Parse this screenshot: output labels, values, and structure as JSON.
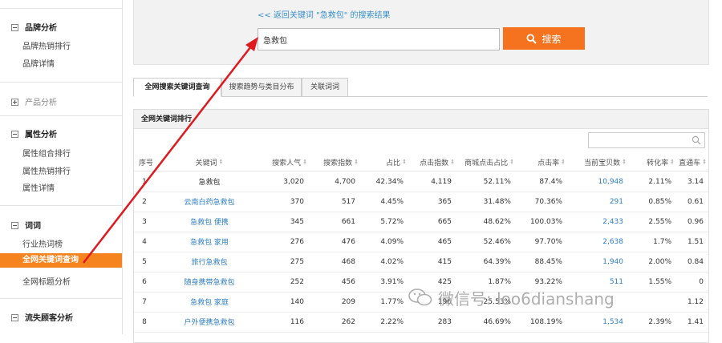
{
  "sidebar": {
    "sections": [
      {
        "title": "品牌分析",
        "collapsed": false,
        "items": [
          "品牌热销排行",
          "品牌详情"
        ]
      },
      {
        "title": "产品分析",
        "collapsed": true,
        "items": []
      },
      {
        "title": "属性分析",
        "collapsed": false,
        "items": [
          "属性组合排行",
          "属性热销排行",
          "属性详情"
        ]
      },
      {
        "title": "词词",
        "collapsed": false,
        "items": [
          "行业热词榜",
          "全网关键词查询",
          "全网标题分析"
        ]
      },
      {
        "title": "流失顾客分析",
        "collapsed": false,
        "items": []
      }
    ],
    "active_item": "全网关键词查询"
  },
  "search": {
    "back_link": "<< 返回关键词 \"急救包\" 的搜索结果",
    "value": "急救包",
    "button_label": "搜索"
  },
  "tabs": [
    "全网搜索关键词查询",
    "搜索趋势与类目分布",
    "关联词词"
  ],
  "panel": {
    "title": "全网关键词排行",
    "filter_placeholder": ""
  },
  "table": {
    "columns": [
      "序号",
      "关键词",
      "搜索人气",
      "搜索指数",
      "占比",
      "点击指数",
      "商城点击占比",
      "点击率",
      "当前宝贝数",
      "转化率",
      "直通车"
    ],
    "rows": [
      [
        "1",
        "急救包",
        "3,020",
        "4,700",
        "42.34%",
        "4,119",
        "52.11%",
        "87.4%",
        "10,948",
        "2.11%",
        "3.14"
      ],
      [
        "2",
        "云南白药急救包",
        "370",
        "517",
        "4.45%",
        "365",
        "31.48%",
        "70.36%",
        "291",
        "0.85%",
        "0.61"
      ],
      [
        "3",
        "急救包 便携",
        "345",
        "661",
        "5.72%",
        "665",
        "48.62%",
        "100.03%",
        "2,433",
        "2.55%",
        "0.96"
      ],
      [
        "4",
        "急救包 家用",
        "276",
        "476",
        "4.09%",
        "465",
        "52.46%",
        "97.70%",
        "2,638",
        "1.7%",
        "1.51"
      ],
      [
        "5",
        "旅行急救包",
        "275",
        "468",
        "4.02%",
        "415",
        "64.39%",
        "88.45%",
        "1,940",
        "2.00%",
        "0.84"
      ],
      [
        "6",
        "随身携带急救包",
        "252",
        "456",
        "3.91%",
        "425",
        "1.87%",
        "93.22%",
        "511",
        "1.55%",
        "0"
      ],
      [
        "7",
        "急救包 家庭",
        "140",
        "209",
        "1.77%",
        "196",
        "25.53%",
        "",
        "",
        "",
        "1.12"
      ],
      [
        "8",
        "户外便携急救包",
        "116",
        "262",
        "2.22%",
        "283",
        "46.69%",
        "108.19%",
        "1,534",
        "2.39%",
        "1.41"
      ]
    ]
  },
  "watermark": {
    "text": "微信号: loo6dianshang"
  },
  "colors": {
    "accent": "#f5841f",
    "search_button": "#f5721e",
    "link": "#2f7fc6",
    "arrow": "#e0191f"
  }
}
